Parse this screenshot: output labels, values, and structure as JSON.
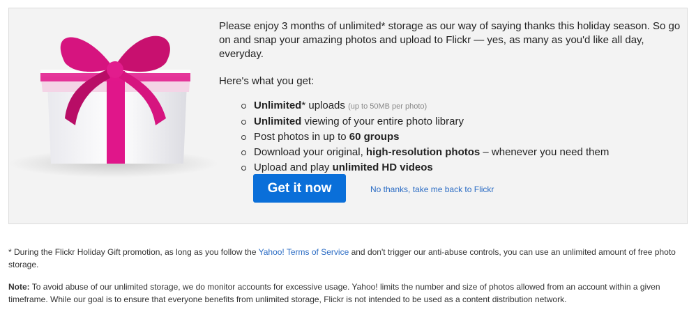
{
  "promo": {
    "intro": "Please enjoy 3 months of unlimited* storage as our way of saying thanks this holiday season. So go on and snap your amazing photos and upload to Flickr — yes, as many as you'd like all day, everyday.",
    "what_you_get": "Here's what you get:",
    "features": [
      {
        "b1": "Unlimited",
        "t1": "* uploads ",
        "small": "(up to 50MB per photo)"
      },
      {
        "b1": "Unlimited",
        "t1": " viewing of your entire photo library"
      },
      {
        "t0": "Post photos in up to ",
        "b1": "60 groups"
      },
      {
        "t0": "Download your original, ",
        "b1": "high-resolution photos",
        "t1": " – whenever you need them"
      },
      {
        "t0": "Upload and play ",
        "b1": "unlimited HD videos"
      }
    ],
    "cta_label": "Get it now",
    "decline_label": "No thanks, take me back to Flickr"
  },
  "footnote": {
    "p1_a": "* During the Flickr Holiday Gift promotion, as long as you follow the ",
    "p1_link": "Yahoo! Terms of Service",
    "p1_b": " and don't trigger our anti-abuse controls, you can use an unlimited amount of free photo storage.",
    "p2_label": "Note:",
    "p2_text": " To avoid abuse of our unlimited storage, we do monitor accounts for excessive usage. Yahoo! limits the number and size of photos allowed from an account within a given timeframe. While our goal is to ensure that everyone benefits from unlimited storage, Flickr is not intended to be used as a content distribution network."
  },
  "colors": {
    "accent": "#0a6fd9",
    "ribbon": "#e0168a",
    "link": "#2b6cc4"
  }
}
